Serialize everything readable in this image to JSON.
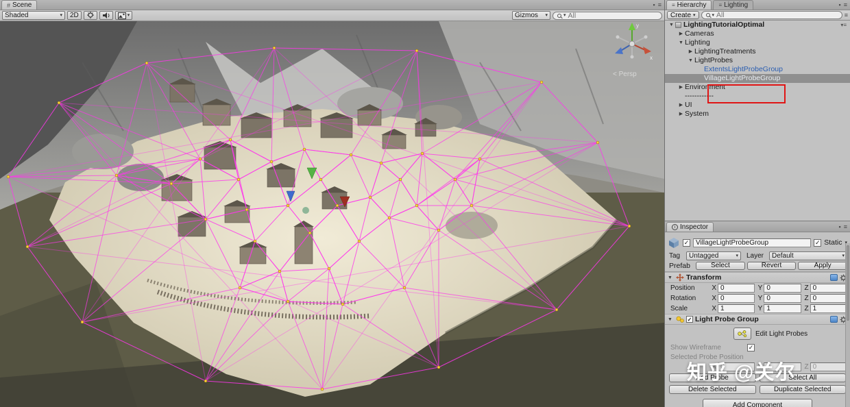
{
  "icons": {
    "caret": "▾",
    "check": "✓",
    "menu": "≡",
    "lock": "▪",
    "grid": "#"
  },
  "watermark": "知乎 @关尔",
  "scene": {
    "tab": "Scene",
    "toolbar": {
      "shaded": "Shaded",
      "mode_2d": "2D",
      "gizmos": "Gizmos",
      "search_value": "All"
    },
    "persp_label": "< Persp",
    "axis_x": "x",
    "axis_y": "y"
  },
  "hierarchy": {
    "tab_hierarchy": "Hierarchy",
    "tab_lighting": "Lighting",
    "create_button": "Create",
    "search_value": "All",
    "items": [
      {
        "label": "LightingTutorialOptimal",
        "indent": 0,
        "arrow": "▼",
        "style": "scene"
      },
      {
        "label": "Cameras",
        "indent": 1,
        "arrow": "▶",
        "style": "normal"
      },
      {
        "label": "Lighting",
        "indent": 1,
        "arrow": "▼",
        "style": "normal"
      },
      {
        "label": "LightingTreatments",
        "indent": 2,
        "arrow": "▶",
        "style": "normal"
      },
      {
        "label": "LightProbes",
        "indent": 2,
        "arrow": "▼",
        "style": "normal"
      },
      {
        "label": "ExtentsLightProbeGroup",
        "indent": 3,
        "arrow": "",
        "style": "prefab"
      },
      {
        "label": "VillageLightProbeGroup",
        "indent": 3,
        "arrow": "",
        "style": "selected"
      },
      {
        "label": "Environment",
        "indent": 1,
        "arrow": "▶",
        "style": "normal"
      },
      {
        "label": "------------",
        "indent": 1,
        "arrow": "",
        "style": "normal"
      },
      {
        "label": "UI",
        "indent": 1,
        "arrow": "▶",
        "style": "normal"
      },
      {
        "label": "System",
        "indent": 1,
        "arrow": "▶",
        "style": "normal"
      }
    ]
  },
  "inspector": {
    "tab": "Inspector",
    "object_name": "VillageLightProbeGroup",
    "static_label": "Static",
    "tag_label": "Tag",
    "tag_value": "Untagged",
    "layer_label": "Layer",
    "layer_value": "Default",
    "prefab_label": "Prefab",
    "prefab_select": "Select",
    "prefab_revert": "Revert",
    "prefab_apply": "Apply",
    "axis_labels": [
      "X",
      "Y",
      "Z"
    ],
    "transform": {
      "title": "Transform",
      "rows": [
        {
          "label": "Position",
          "values": [
            "0",
            "0",
            "0"
          ]
        },
        {
          "label": "Rotation",
          "values": [
            "0",
            "0",
            "0"
          ]
        },
        {
          "label": "Scale",
          "values": [
            "1",
            "1",
            "1"
          ]
        }
      ]
    },
    "light_probe_group": {
      "title": "Light Probe Group",
      "edit_button": "Edit Light Probes",
      "show_wireframe_label": "Show Wireframe",
      "selected_probe_label": "Selected Probe Position",
      "probe_values": [
        "0",
        "0",
        "0"
      ],
      "btn_add_probe": "Add Probe",
      "btn_select_all": "Select All",
      "btn_delete_selected": "Delete Selected",
      "btn_duplicate_selected": "Duplicate Selected"
    },
    "add_component": "Add Component"
  }
}
